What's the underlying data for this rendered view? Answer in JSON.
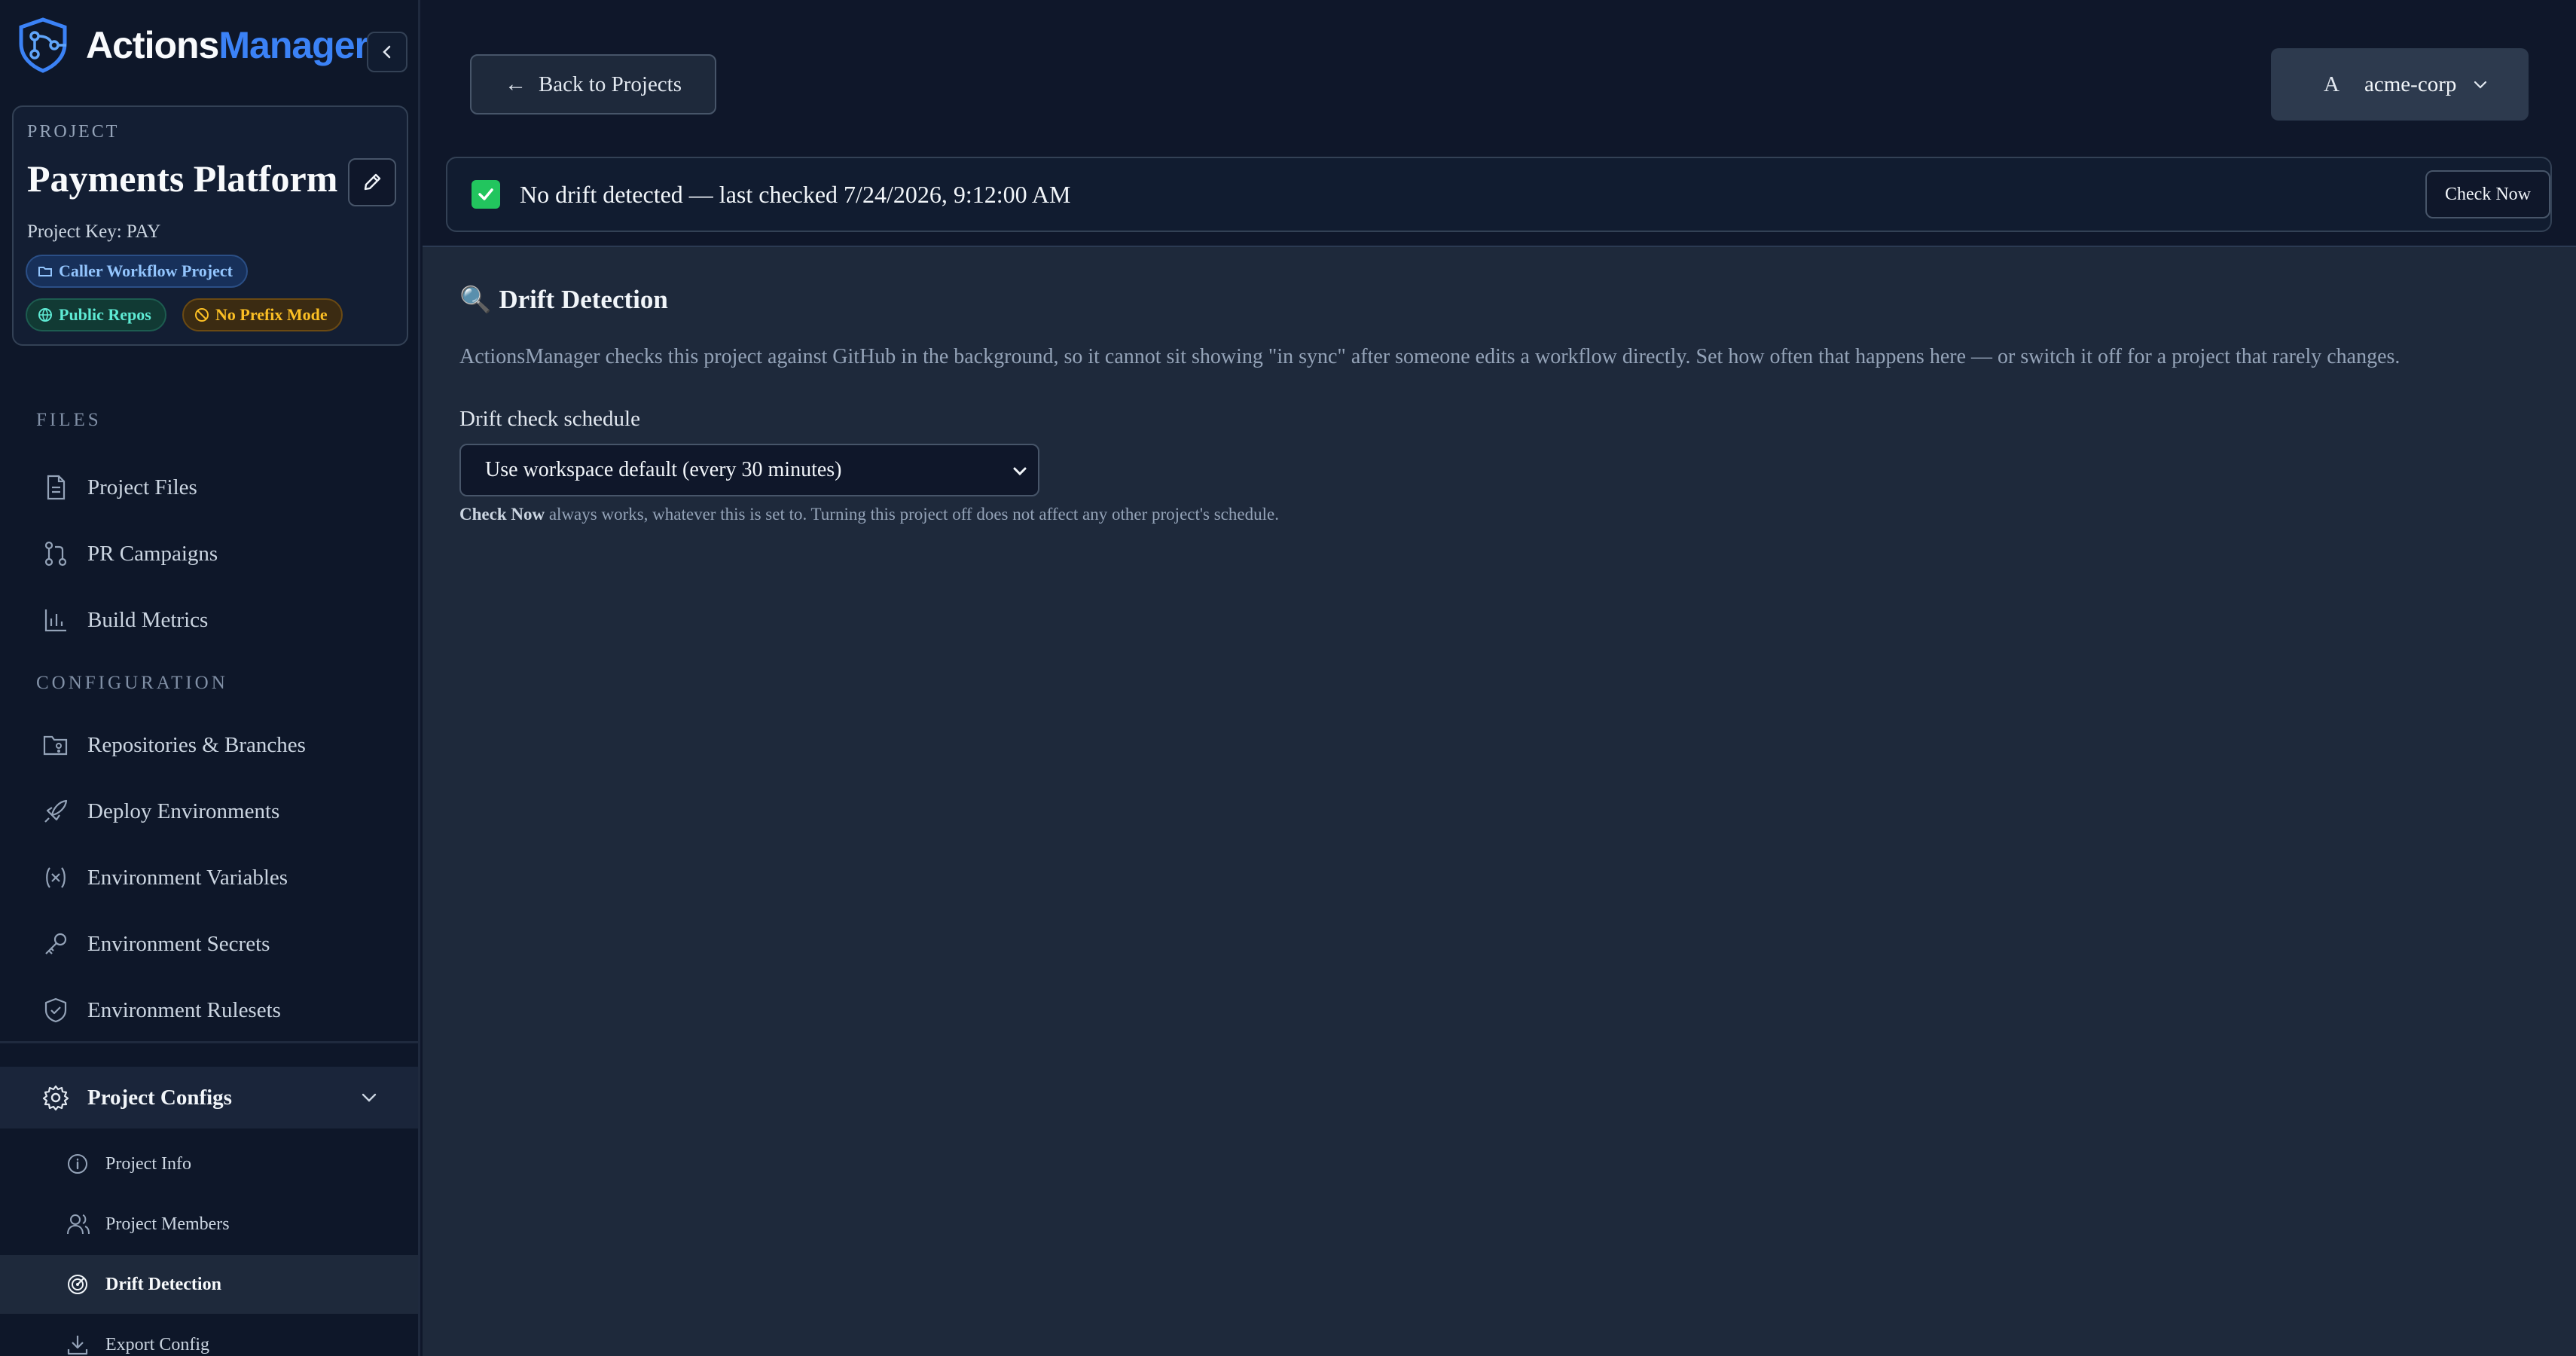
{
  "brand": {
    "name_part1": "Actions",
    "name_part2": "Manager"
  },
  "project": {
    "section_label": "PROJECT",
    "name": "Payments Platform",
    "key_text": "Project Key: PAY",
    "chips": {
      "caller": "Caller Workflow Project",
      "public": "Public Repos",
      "prefix": "No Prefix Mode"
    }
  },
  "nav": {
    "files_label": "FILES",
    "files": [
      "Project Files",
      "PR Campaigns",
      "Build Metrics"
    ],
    "config_label": "CONFIGURATION",
    "config": [
      "Repositories & Branches",
      "Deploy Environments",
      "Environment Variables",
      "Environment Secrets",
      "Environment Rulesets"
    ],
    "group": "Project Configs",
    "sub": [
      "Project Info",
      "Project Members",
      "Drift Detection",
      "Export Config"
    ],
    "active_sub": "Drift Detection"
  },
  "header": {
    "back_arrow": "←",
    "back_label": "Back to Projects",
    "org_avatar": "A",
    "org_name": "acme-corp"
  },
  "status": {
    "text": "No drift detected — last checked 7/24/2026, 9:12:00 AM",
    "button": "Check Now",
    "color": "#22c55e"
  },
  "panel": {
    "emoji": "🔍",
    "title": "Drift Detection",
    "description": "ActionsManager checks this project against GitHub in the background, so it cannot sit showing \"in sync\" after someone edits a workflow directly. Set how often that happens here — or switch it off for a project that rarely changes.",
    "field_label": "Drift check schedule",
    "select_value": "Use workspace default (every 30 minutes)",
    "help_bold": "Check Now",
    "help_rest": " always works, whatever this is set to. Turning this project off does not affect any other project's schedule."
  },
  "colors": {
    "accent": "#3b82f6",
    "background": "#0f172a",
    "panel": "#1e293b"
  }
}
